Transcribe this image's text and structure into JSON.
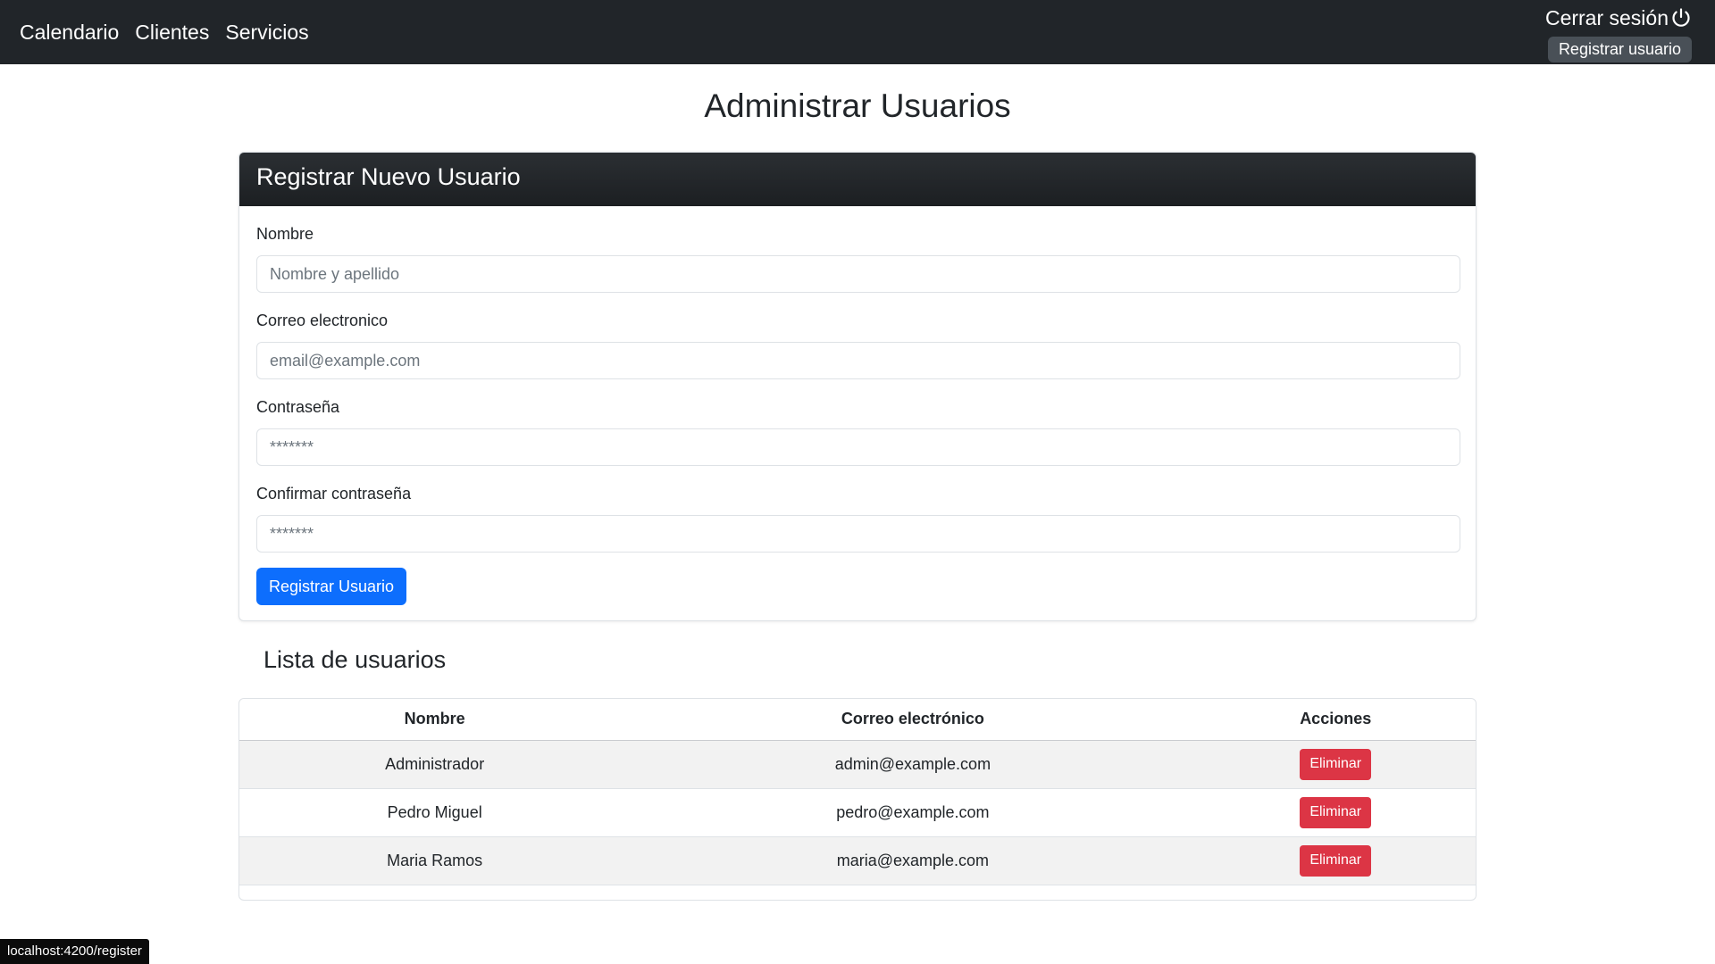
{
  "navbar": {
    "links": [
      "Calendario",
      "Clientes",
      "Servicios"
    ],
    "logout_label": "Cerrar sesión",
    "logout_icon": "power-icon",
    "register_label": "Registrar usuario",
    "background_color": "#212529"
  },
  "page": {
    "title": "Administrar Usuarios"
  },
  "register_card": {
    "header": "Registrar Nuevo Usuario",
    "fields": [
      {
        "label": "Nombre",
        "placeholder": "Nombre y apellido",
        "value": ""
      },
      {
        "label": "Correo electronico",
        "placeholder": "email@example.com",
        "value": ""
      },
      {
        "label": "Contraseña",
        "placeholder": "*******",
        "value": ""
      },
      {
        "label": "Confirmar contraseña",
        "placeholder": "*******",
        "value": ""
      }
    ],
    "submit_label": "Registrar Usuario",
    "submit_color": "#0d6efd"
  },
  "user_list": {
    "title": "Lista de usuarios",
    "columns": [
      "Nombre",
      "Correo electrónico",
      "Acciones"
    ],
    "rows": [
      {
        "name": "Administrador",
        "email": "admin@example.com",
        "action": "Eliminar"
      },
      {
        "name": "Pedro Miguel",
        "email": "pedro@example.com",
        "action": "Eliminar"
      },
      {
        "name": "Maria Ramos",
        "email": "maria@example.com",
        "action": "Eliminar"
      }
    ],
    "delete_color": "#dc3545"
  },
  "status_bar": {
    "url": "localhost:4200/register"
  }
}
